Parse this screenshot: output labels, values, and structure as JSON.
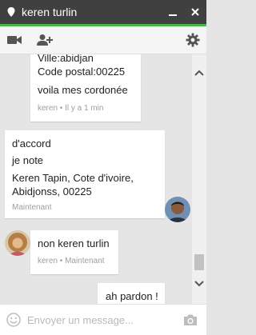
{
  "window": {
    "contact_name": "keren turlin",
    "accent_color": "#4ab34a",
    "icons": [
      "location-pin-icon",
      "minimize-icon",
      "close-icon"
    ]
  },
  "toolbar": {
    "icons": [
      "video-call-icon",
      "add-person-icon",
      "settings-gear-icon"
    ]
  },
  "messages": [
    {
      "side": "left",
      "lines": [
        "Ville:abidjan",
        "Code postal:00225",
        "voila mes cordonée"
      ],
      "meta": "keren • Il y a 1 min"
    },
    {
      "side": "right",
      "lines": [
        "d'accord",
        "je note",
        "Keren Tapin, Cote d'ivoire,",
        "Abidjonss, 00225"
      ],
      "meta": "Maintenant"
    },
    {
      "side": "left",
      "lines": [
        "non keren turlin"
      ],
      "meta": "keren • Maintenant"
    },
    {
      "side": "right",
      "lines": [
        "ah pardon !"
      ],
      "meta": ""
    }
  ],
  "input": {
    "placeholder": "Envoyer un message..."
  }
}
